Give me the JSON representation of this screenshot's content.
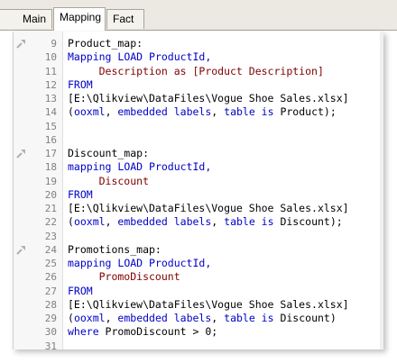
{
  "tabs": [
    {
      "label": "Main"
    },
    {
      "label": "Mapping"
    },
    {
      "label": "Fact"
    }
  ],
  "editor": {
    "lines": [
      {
        "n": "9",
        "fold": true,
        "segs": [
          {
            "t": "Product_map:",
            "c": "p"
          }
        ]
      },
      {
        "n": "10",
        "fold": false,
        "segs": [
          {
            "t": "Mapping ",
            "c": "kw"
          },
          {
            "t": "LOAD ",
            "c": "kw"
          },
          {
            "t": "ProductId,",
            "c": "kw"
          }
        ]
      },
      {
        "n": "11",
        "fold": false,
        "segs": [
          {
            "t": "     Description as [Product Description]",
            "c": "fld"
          }
        ]
      },
      {
        "n": "12",
        "fold": false,
        "segs": [
          {
            "t": "FROM",
            "c": "kw"
          }
        ]
      },
      {
        "n": "13",
        "fold": false,
        "segs": [
          {
            "t": "[E:\\Qlikview\\DataFiles\\Vogue Shoe Sales.xlsx]",
            "c": "p"
          }
        ]
      },
      {
        "n": "14",
        "fold": false,
        "segs": [
          {
            "t": "(",
            "c": "p"
          },
          {
            "t": "ooxml",
            "c": "kw"
          },
          {
            "t": ", ",
            "c": "p"
          },
          {
            "t": "embedded labels",
            "c": "kw"
          },
          {
            "t": ", ",
            "c": "p"
          },
          {
            "t": "table is ",
            "c": "kw"
          },
          {
            "t": "Product);",
            "c": "p"
          }
        ]
      },
      {
        "n": "15",
        "fold": false,
        "segs": []
      },
      {
        "n": "16",
        "fold": false,
        "segs": []
      },
      {
        "n": "17",
        "fold": true,
        "segs": [
          {
            "t": "Discount_map:",
            "c": "p"
          }
        ]
      },
      {
        "n": "18",
        "fold": false,
        "segs": [
          {
            "t": "mapping ",
            "c": "kw"
          },
          {
            "t": "LOAD ",
            "c": "kw"
          },
          {
            "t": "ProductId,",
            "c": "kw"
          }
        ]
      },
      {
        "n": "19",
        "fold": false,
        "segs": [
          {
            "t": "     Discount",
            "c": "fld"
          }
        ]
      },
      {
        "n": "20",
        "fold": false,
        "segs": [
          {
            "t": "FROM",
            "c": "kw"
          }
        ]
      },
      {
        "n": "21",
        "fold": false,
        "segs": [
          {
            "t": "[E:\\Qlikview\\DataFiles\\Vogue Shoe Sales.xlsx]",
            "c": "p"
          }
        ]
      },
      {
        "n": "22",
        "fold": false,
        "segs": [
          {
            "t": "(",
            "c": "p"
          },
          {
            "t": "ooxml",
            "c": "kw"
          },
          {
            "t": ", ",
            "c": "p"
          },
          {
            "t": "embedded labels",
            "c": "kw"
          },
          {
            "t": ", ",
            "c": "p"
          },
          {
            "t": "table is ",
            "c": "kw"
          },
          {
            "t": "Discount);",
            "c": "p"
          }
        ]
      },
      {
        "n": "23",
        "fold": false,
        "segs": []
      },
      {
        "n": "24",
        "fold": true,
        "segs": [
          {
            "t": "Promotions_map:",
            "c": "p"
          }
        ]
      },
      {
        "n": "25",
        "fold": false,
        "segs": [
          {
            "t": "mapping ",
            "c": "kw"
          },
          {
            "t": "LOAD ",
            "c": "kw"
          },
          {
            "t": "ProductId,",
            "c": "kw"
          }
        ]
      },
      {
        "n": "26",
        "fold": false,
        "segs": [
          {
            "t": "     PromoDiscount",
            "c": "fld"
          }
        ]
      },
      {
        "n": "27",
        "fold": false,
        "segs": [
          {
            "t": "FROM",
            "c": "kw"
          }
        ]
      },
      {
        "n": "28",
        "fold": false,
        "segs": [
          {
            "t": "[E:\\Qlikview\\DataFiles\\Vogue Shoe Sales.xlsx]",
            "c": "p"
          }
        ]
      },
      {
        "n": "29",
        "fold": false,
        "segs": [
          {
            "t": "(",
            "c": "p"
          },
          {
            "t": "ooxml",
            "c": "kw"
          },
          {
            "t": ", ",
            "c": "p"
          },
          {
            "t": "embedded labels",
            "c": "kw"
          },
          {
            "t": ", ",
            "c": "p"
          },
          {
            "t": "table is ",
            "c": "kw"
          },
          {
            "t": "Discount)",
            "c": "p"
          }
        ]
      },
      {
        "n": "30",
        "fold": false,
        "segs": [
          {
            "t": "where ",
            "c": "kw"
          },
          {
            "t": "PromoDiscount > 0;",
            "c": "p"
          }
        ]
      },
      {
        "n": "31",
        "fold": false,
        "segs": []
      }
    ]
  }
}
